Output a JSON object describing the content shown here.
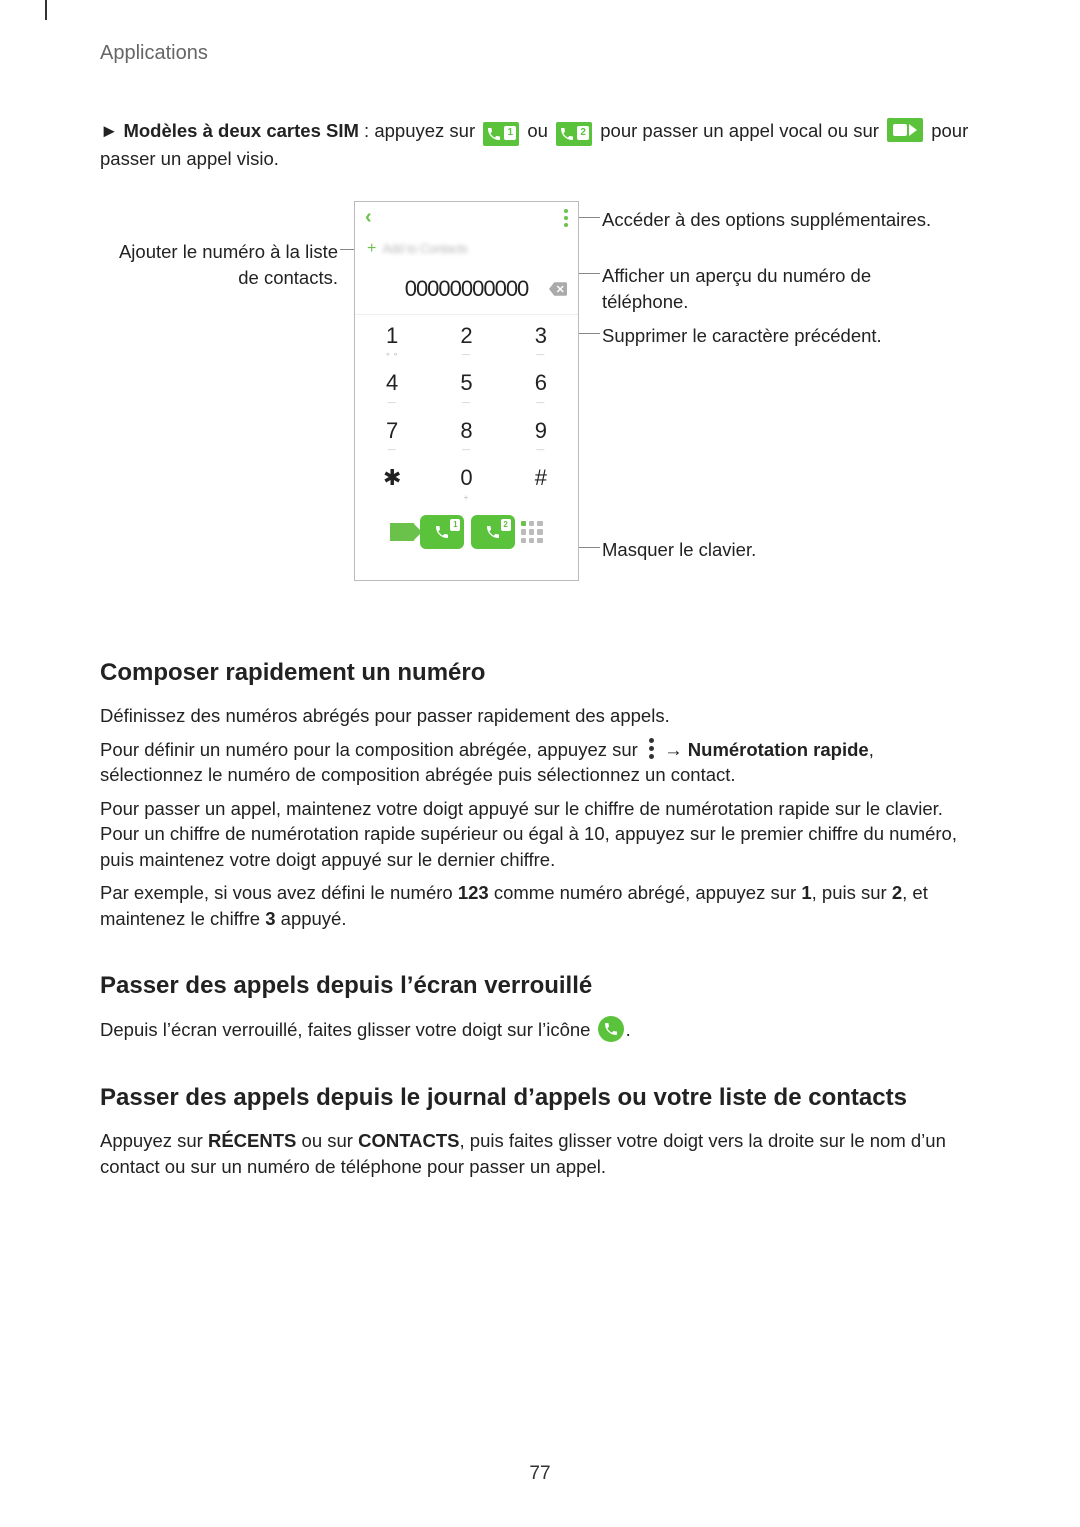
{
  "header": {
    "section": "Applications"
  },
  "intro": {
    "prefix": "►",
    "bold_lead": "Modèles à deux cartes SIM",
    "after_bold": " : appuyez sur ",
    "or": " ou ",
    "after_icons": " pour passer un appel vocal ou sur ",
    "tail": " pour passer un appel visio."
  },
  "phone": {
    "number": "00000000000",
    "add_contact_blur": "Add to Contacts",
    "keys": [
      {
        "d": "1",
        "sub": "⚬⚬"
      },
      {
        "d": "2",
        "sub": "—"
      },
      {
        "d": "3",
        "sub": "—"
      },
      {
        "d": "4",
        "sub": "—"
      },
      {
        "d": "5",
        "sub": "—"
      },
      {
        "d": "6",
        "sub": "—"
      },
      {
        "d": "7",
        "sub": "—"
      },
      {
        "d": "8",
        "sub": "—"
      },
      {
        "d": "9",
        "sub": "—"
      },
      {
        "d": "✱",
        "sub": ""
      },
      {
        "d": "0",
        "sub": "+"
      },
      {
        "d": "#",
        "sub": ""
      }
    ],
    "sim1": "1",
    "sim2": "2"
  },
  "callouts": {
    "left_add": "Ajouter le numéro à la liste de contacts.",
    "r_options": "Accéder à des options supplémentaires.",
    "r_preview": "Afficher un aperçu du numéro de téléphone.",
    "r_delete": "Supprimer le caractère précédent.",
    "r_hide": "Masquer le clavier."
  },
  "h_compose": "Composer rapidement un numéro",
  "compose_p1": "Définissez des numéros abrégés pour passer rapidement des appels.",
  "compose_p2a": "Pour définir un numéro pour la composition abrégée, appuyez sur ",
  "compose_arrow": "→ ",
  "compose_bold": "Numérotation rapide",
  "compose_p2b": ", sélectionnez le numéro de composition abrégée puis sélectionnez un contact.",
  "compose_p3": "Pour passer un appel, maintenez votre doigt appuyé sur le chiffre de numérotation rapide sur le clavier. Pour un chiffre de numérotation rapide supérieur ou égal à 10, appuyez sur le premier chiffre du numéro, puis maintenez votre doigt appuyé sur le dernier chiffre.",
  "compose_p4a": "Par exemple, si vous avez défini le numéro ",
  "num123": "123",
  "compose_p4b": " comme numéro abrégé, appuyez sur ",
  "n1": "1",
  "compose_p4c": ", puis sur ",
  "n2": "2",
  "compose_p4d": ", et maintenez le chiffre ",
  "n3": "3",
  "compose_p4e": " appuyé.",
  "h_lock": "Passer des appels depuis l’écran verrouillé",
  "lock_p1a": "Depuis l’écran verrouillé, faites glisser votre doigt sur l’icône ",
  "lock_p1b": ".",
  "h_log": "Passer des appels depuis le journal d’appels ou votre liste de contacts",
  "log_p1a": "Appuyez sur ",
  "log_b1": "RÉCENTS",
  "log_p1b": " ou sur ",
  "log_b2": "CONTACTS",
  "log_p1c": ", puis faites glisser votre doigt vers la droite sur le nom d’un contact ou sur un numéro de téléphone pour passer un appel.",
  "page_number": "77"
}
